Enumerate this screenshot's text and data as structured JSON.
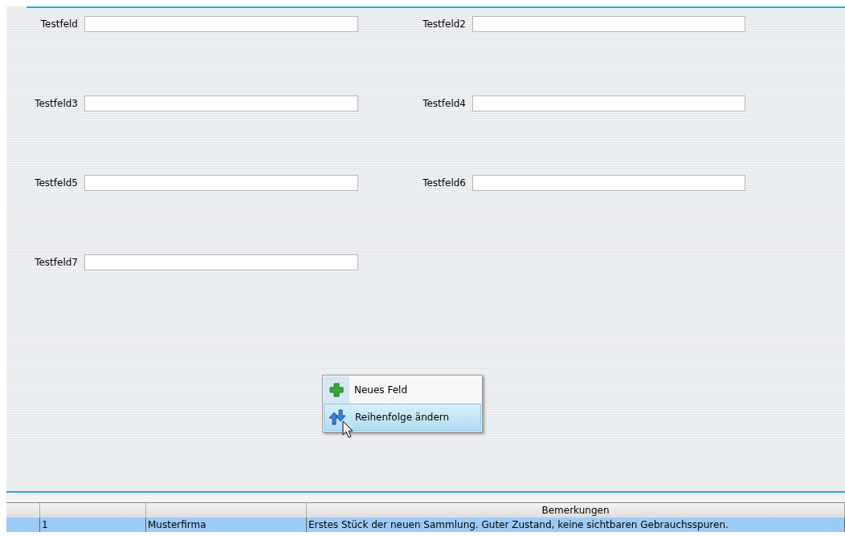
{
  "fields": [
    {
      "label": "Testfeld"
    },
    {
      "label": "Testfeld2"
    },
    {
      "label": "Testfeld3"
    },
    {
      "label": "Testfeld4"
    },
    {
      "label": "Testfeld5"
    },
    {
      "label": "Testfeld6"
    },
    {
      "label": "Testfeld7"
    }
  ],
  "context_menu": [
    {
      "kind": "add",
      "label": "Neues Feld",
      "selected": false
    },
    {
      "kind": "reorder",
      "label": "Reihenfolge ändern",
      "selected": true
    }
  ],
  "table": {
    "column_4_heading": "Bemerkungen",
    "rows": [
      {
        "selected": true,
        "cells": [
          "1",
          "Musterfirma",
          "Erstes Stück der neuen Sammlung. Guter Zustand, keine sichtbaren Gebrauchsspuren."
        ]
      }
    ]
  }
}
